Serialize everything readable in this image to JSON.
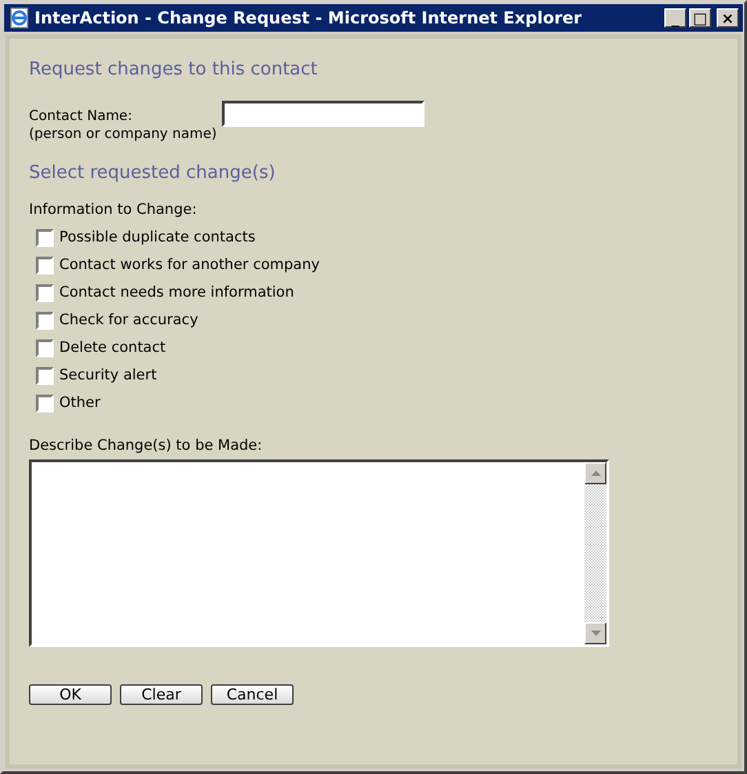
{
  "window": {
    "title": "InterAction - Change Request - Microsoft Internet Explorer",
    "controls": [
      "_",
      "□",
      "×"
    ]
  },
  "heading": "Request changes to this contact",
  "contact_name": {
    "label": "Contact Name:",
    "hint": "(person or company name)"
  },
  "section_heading": "Select requested change(s)",
  "information_label": "Information to Change:",
  "options": [
    {
      "label": "Possible duplicate contacts",
      "checked": false
    },
    {
      "label": "Contact works for another company",
      "checked": false
    },
    {
      "label": "Contact needs more information",
      "checked": false
    },
    {
      "label": "Check for accuracy",
      "checked": false
    },
    {
      "label": "Delete contact",
      "checked": false
    },
    {
      "label": "Security alert",
      "checked": false
    },
    {
      "label": "Other",
      "checked": false
    }
  ],
  "describe": {
    "label": "Describe Change(s) to be Made:"
  },
  "buttons": [
    "OK",
    "Clear",
    "Cancel"
  ]
}
